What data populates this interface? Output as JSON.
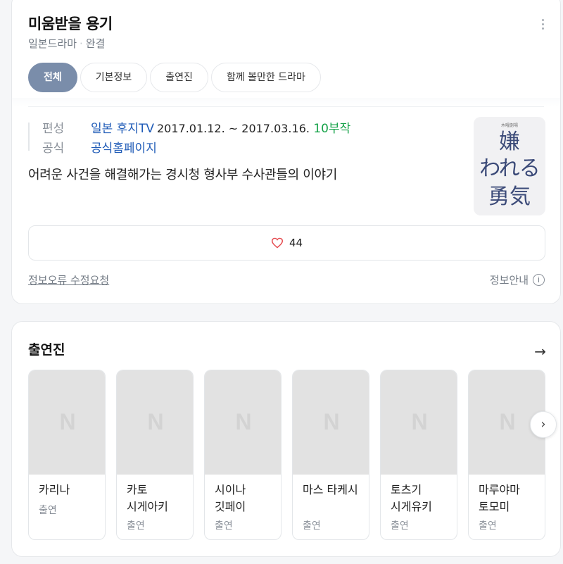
{
  "drama": {
    "title": "미움받을 용기",
    "category": "일본드라마",
    "status": "완결"
  },
  "tabs": [
    {
      "label": "전체",
      "active": true
    },
    {
      "label": "기본정보",
      "active": false
    },
    {
      "label": "출연진",
      "active": false
    },
    {
      "label": "함께 볼만한 드라마",
      "active": false
    }
  ],
  "meta": {
    "broadcast_key": "편성",
    "broadcaster": "일본 후지TV",
    "dates": "2017.01.12. ~ 2017.03.16.",
    "episodes": "10부작",
    "official_key": "공식",
    "official_link": "공식홈페이지"
  },
  "description": "어려운 사건을 해결해가는 경시청 형사부 수사관들의 이야기",
  "poster": {
    "small_text": "木曜劇場",
    "line1": "嫌",
    "line2": "われる",
    "line3": "勇気"
  },
  "like": {
    "icon": "heart-icon",
    "count": "44"
  },
  "footer": {
    "report_link": "정보오류 수정요청",
    "guide_label": "정보안내",
    "guide_icon_glyph": "i"
  },
  "cast": {
    "section_title": "출연진",
    "arrow_glyph": "→",
    "next_glyph": "›",
    "placeholder_glyph": "N",
    "people": [
      {
        "name": "카리나",
        "role": "출연"
      },
      {
        "name": "카토 시게아키",
        "role": "출연"
      },
      {
        "name": "시이나 깃페이",
        "role": "출연"
      },
      {
        "name": "마스 타케시",
        "role": "출연"
      },
      {
        "name": "토츠기 시게유키",
        "role": "출연"
      },
      {
        "name": "마루야마 토모미",
        "role": "출연"
      }
    ]
  },
  "colors": {
    "active_tab": "#7a8daa",
    "link": "#1f5bb7",
    "episode_count": "#17a34a",
    "heart": "#e5484d"
  }
}
